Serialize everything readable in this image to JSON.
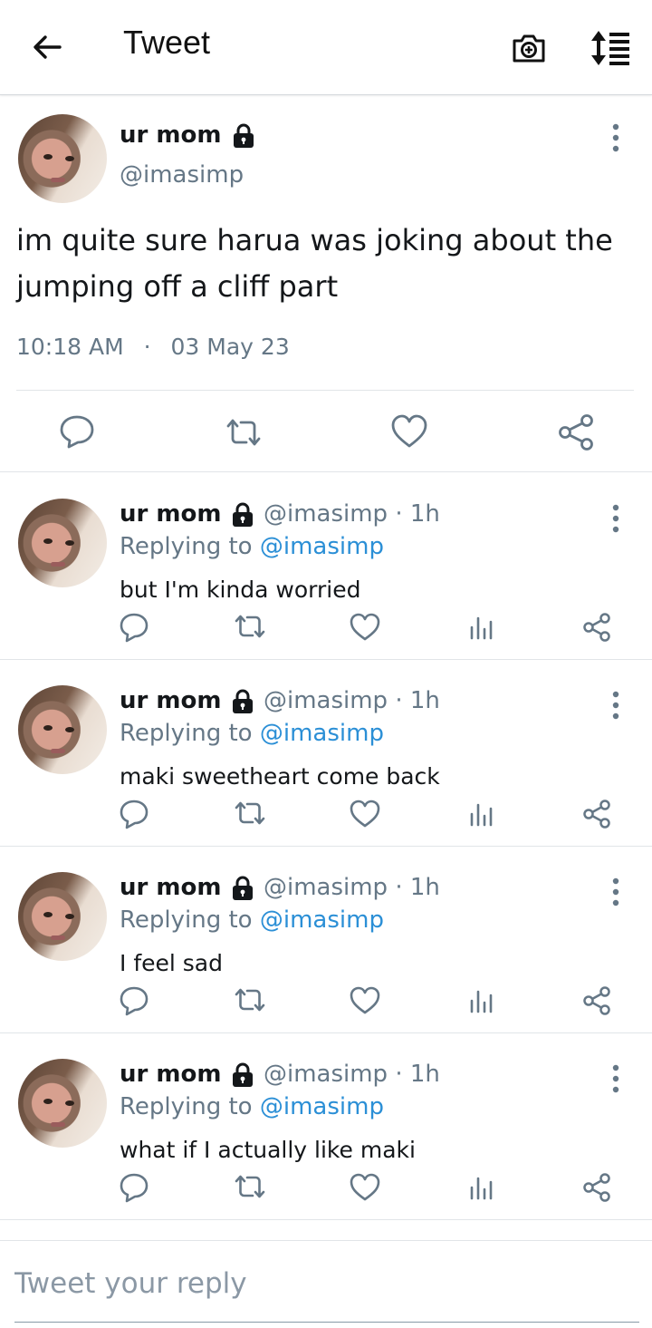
{
  "header": {
    "title": "Tweet"
  },
  "main_tweet": {
    "name": "ur mom",
    "handle": "@imasimp",
    "text": "im quite sure harua was joking about the jumping off a cliff part",
    "time": "10:18 AM",
    "date": "03 May 23"
  },
  "replies": [
    {
      "name": "ur mom",
      "handle": "@imasimp",
      "age": "· 1h",
      "replying_label": "Replying to",
      "replying_handle": "@imasimp",
      "text": "but I'm kinda worried"
    },
    {
      "name": "ur mom",
      "handle": "@imasimp",
      "age": "· 1h",
      "replying_label": "Replying to",
      "replying_handle": "@imasimp",
      "text": "maki sweetheart come back"
    },
    {
      "name": "ur mom",
      "handle": "@imasimp",
      "age": "· 1h",
      "replying_label": "Replying to",
      "replying_handle": "@imasimp",
      "text": "I feel sad"
    },
    {
      "name": "ur mom",
      "handle": "@imasimp",
      "age": "· 1h",
      "replying_label": "Replying to",
      "replying_handle": "@imasimp",
      "text": "what if I actually like maki"
    }
  ],
  "composer": {
    "placeholder": "Tweet your reply"
  },
  "colors": {
    "icon": "#657786",
    "link": "#2b8fd6",
    "text": "#14171a",
    "secondary": "#657786"
  }
}
